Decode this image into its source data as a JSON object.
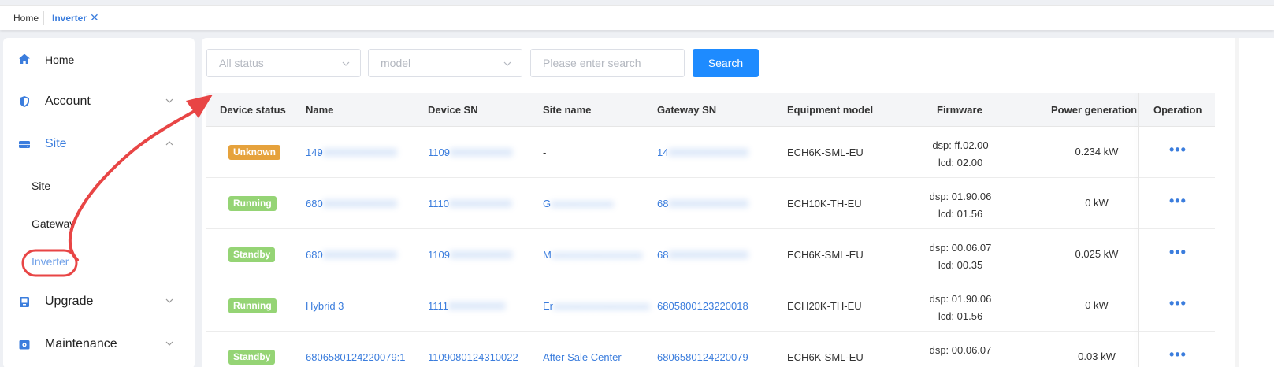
{
  "tabs": {
    "home": "Home",
    "inverter": "Inverter"
  },
  "sidebar": {
    "home": "Home",
    "account": "Account",
    "site": "Site",
    "site_sub": [
      "Site",
      "Gateway",
      "Inverter"
    ],
    "upgrade": "Upgrade",
    "maintenance": "Maintenance"
  },
  "filters": {
    "status_placeholder": "All status",
    "model_placeholder": "model",
    "search_placeholder": "Please enter search",
    "search_button": "Search"
  },
  "table": {
    "columns": [
      "Device status",
      "Name",
      "Device SN",
      "Site name",
      "Gateway SN",
      "Equipment model",
      "Firmware",
      "Power generation",
      "Operation"
    ],
    "rows": [
      {
        "status": "Unknown",
        "status_color": "#e6a23c",
        "name": "149",
        "name_rest": "0000000000000",
        "device_sn": "1109",
        "device_sn_rest": "00000000000",
        "site": "-",
        "site_rest": "",
        "gateway_sn": "14",
        "gateway_rest": "00000000000000",
        "model": "ECH6K-SML-EU",
        "dsp": "dsp: ff.02.00",
        "lcd": "lcd: 02.00",
        "power": "0.234 kW"
      },
      {
        "status": "Running",
        "status_color": "#95d475",
        "name": "680",
        "name_rest": "0000000000000",
        "device_sn": "1110",
        "device_sn_rest": "00000000000",
        "site": "G",
        "site_rest": "ooooooooooo",
        "gateway_sn": "68",
        "gateway_rest": "00000000000000",
        "model": "ECH10K-TH-EU",
        "dsp": "dsp: 01.90.06",
        "lcd": "lcd: 01.56",
        "power": "0 kW"
      },
      {
        "status": "Standby",
        "status_color": "#95d475",
        "name": "680",
        "name_rest": "0000000000000",
        "device_sn": "1109",
        "device_sn_rest": "00000000000",
        "site": "M",
        "site_rest": "oooooooooooooooo",
        "gateway_sn": "68",
        "gateway_rest": "00000000000000",
        "model": "ECH6K-SML-EU",
        "dsp": "dsp: 00.06.07",
        "lcd": "lcd: 00.35",
        "power": "0.025 kW"
      },
      {
        "status": "Running",
        "status_color": "#95d475",
        "name": "Hybrid 3",
        "name_rest": "",
        "device_sn": "1111",
        "device_sn_rest": "0000000000",
        "site": "Er",
        "site_rest": "ooooooooooooooooo",
        "gateway_sn": "6805800123220018",
        "gateway_rest": "",
        "model": "ECH20K-TH-EU",
        "dsp": "dsp: 01.90.06",
        "lcd": "lcd: 01.56",
        "power": "0 kW"
      },
      {
        "status": "Standby",
        "status_color": "#95d475",
        "name": "6806580124220079:1",
        "name_rest": "",
        "device_sn": "1109080124310022",
        "device_sn_rest": "",
        "site": "After Sale Center",
        "site_rest": "",
        "gateway_sn": "6806580124220079",
        "gateway_rest": "",
        "model": "ECH6K-SML-EU",
        "dsp": "dsp: 00.06.07",
        "lcd": "",
        "power": "0.03 kW"
      }
    ]
  },
  "colors": {
    "accent": "#1e8bff",
    "link": "#3b7ddd",
    "annotation": "#e84545"
  }
}
